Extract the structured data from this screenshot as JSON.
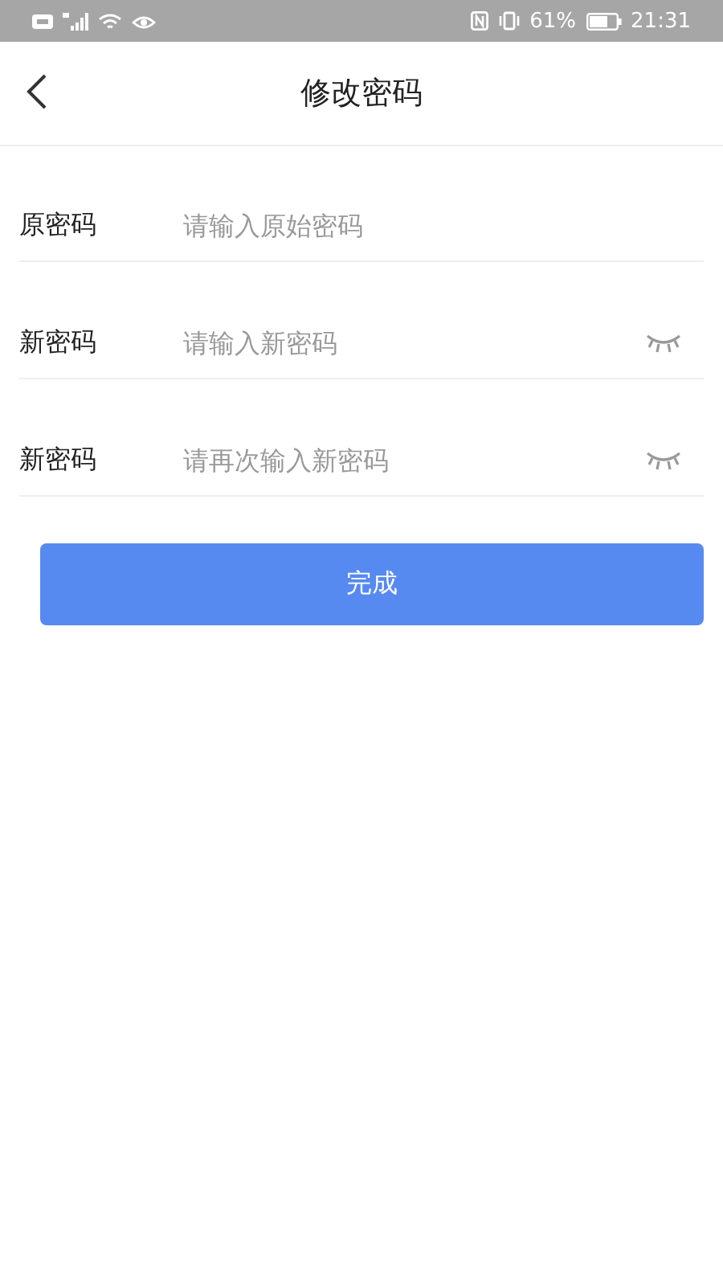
{
  "status_bar": {
    "battery_percent": "61%",
    "time": "21:31"
  },
  "header": {
    "title": "修改密码"
  },
  "fields": [
    {
      "kind": "plain",
      "label": "原密码",
      "placeholder": "请输入原始密码"
    },
    {
      "kind": "toggle",
      "label": "新密码",
      "placeholder": "请输入新密码",
      "visible": false
    },
    {
      "kind": "toggle",
      "label": "新密码",
      "placeholder": "请再次输入新密码",
      "visible": false
    }
  ],
  "submit": "完成"
}
